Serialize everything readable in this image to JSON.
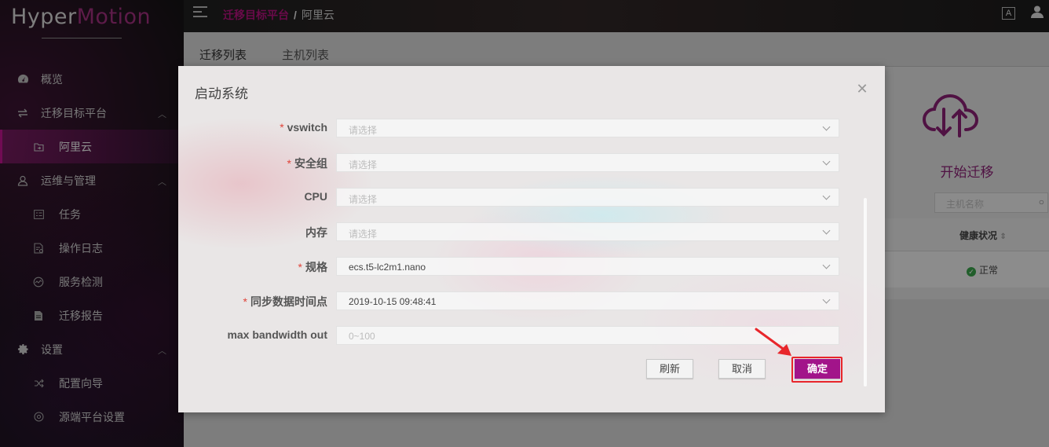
{
  "app": {
    "logo_part1": "Hyper",
    "logo_part2": "Motion"
  },
  "sidebar": {
    "items": [
      {
        "label": "概览",
        "icon": "dashboard-icon",
        "level": 1
      },
      {
        "label": "迁移目标平台",
        "icon": "swap-icon",
        "level": 1,
        "expanded": true
      },
      {
        "label": "阿里云",
        "icon": "folder-icon",
        "level": 2,
        "active": true
      },
      {
        "label": "运维与管理",
        "icon": "user-icon",
        "level": 1,
        "expanded": true
      },
      {
        "label": "任务",
        "icon": "list-icon",
        "level": 2
      },
      {
        "label": "操作日志",
        "icon": "log-icon",
        "level": 2
      },
      {
        "label": "服务检测",
        "icon": "monitor-icon",
        "level": 2
      },
      {
        "label": "迁移报告",
        "icon": "report-icon",
        "level": 2
      },
      {
        "label": "设置",
        "icon": "gear-icon",
        "level": 1,
        "expanded": true
      },
      {
        "label": "配置向导",
        "icon": "shuffle-icon",
        "level": 2
      },
      {
        "label": "源端平台设置",
        "icon": "target-icon",
        "level": 2
      }
    ]
  },
  "topbar": {
    "breadcrumb": {
      "parent": "迁移目标平台",
      "separator": "/",
      "current": "阿里云"
    },
    "font_icon_label": "A"
  },
  "main": {
    "tabs": [
      {
        "label": "迁移列表"
      },
      {
        "label": "主机列表"
      }
    ],
    "start_label": "开始迁移",
    "host_search_placeholder": "主机名称",
    "table": {
      "health_header": "健康状况",
      "status": "正常"
    }
  },
  "dialog": {
    "title": "启动系统",
    "fields": [
      {
        "label": "vswitch",
        "required": true,
        "value": "请选择",
        "placeholder": true
      },
      {
        "label": "安全组",
        "required": true,
        "value": "请选择",
        "placeholder": true
      },
      {
        "label": "CPU",
        "required": false,
        "value": "请选择",
        "placeholder": true
      },
      {
        "label": "内存",
        "required": false,
        "value": "请选择",
        "placeholder": true
      },
      {
        "label": "规格",
        "required": true,
        "value": "ecs.t5-lc2m1.nano",
        "placeholder": false
      },
      {
        "label": "同步数据时间点",
        "required": true,
        "value": "2019-10-15 09:48:41",
        "placeholder": false
      },
      {
        "label": "max bandwidth out",
        "required": false,
        "value": "0~100",
        "placeholder": true,
        "input": true
      }
    ],
    "buttons": {
      "refresh": "刷新",
      "cancel": "取消",
      "confirm": "确定"
    }
  },
  "colors": {
    "accent": "#a2148a",
    "breadcrumb_link": "#b5127f",
    "highlight_box": "#e8262b",
    "status_ok": "#3aa34a"
  }
}
